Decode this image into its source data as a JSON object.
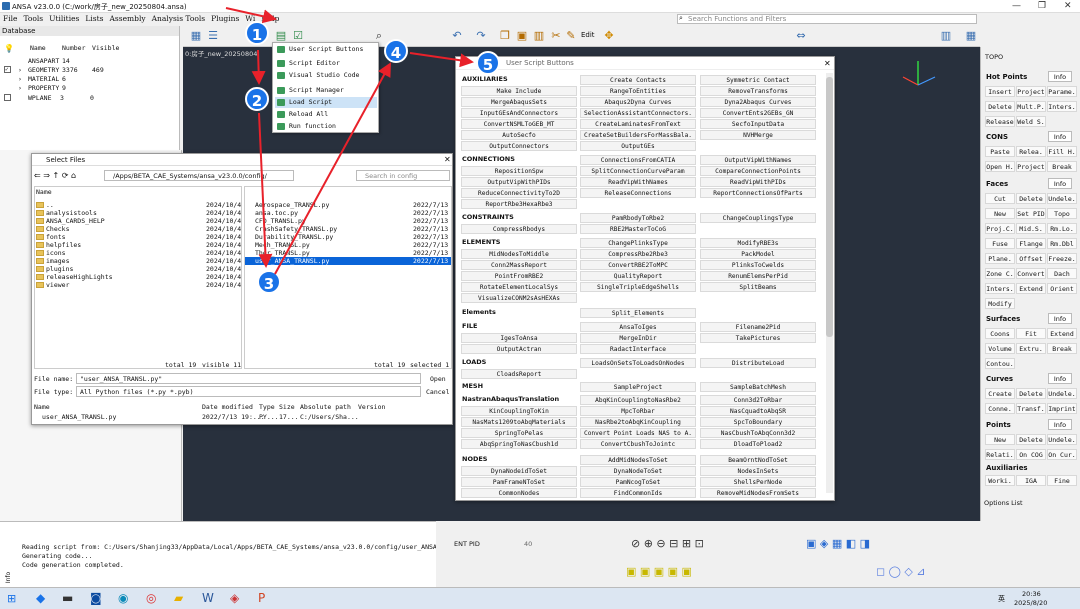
{
  "titlebar": {
    "title": "ANSA v23.0.0 (C:/work/房子_new_20250804.ansa)"
  },
  "menu": [
    "File",
    "Tools",
    "Utilities",
    "Lists",
    "Assembly",
    "Analysis Tools",
    "Plugins",
    "Wi",
    "Help"
  ],
  "search": {
    "placeholder": "Search Functions and Filters"
  },
  "toolbar": {
    "edit_label": "Edit"
  },
  "database": {
    "header": "Database",
    "columns": [
      "Name",
      "Number",
      "Visible"
    ],
    "rows": [
      {
        "name": "ANSAPART",
        "num": "14",
        "vis": ""
      },
      {
        "name": "GEOMETRY",
        "num": "3376",
        "vis": "469"
      },
      {
        "name": "MATERIAL",
        "num": "6",
        "vis": ""
      },
      {
        "name": "PROPERTY",
        "num": "9",
        "vis": ""
      },
      {
        "name": "WPLANE",
        "num": "3",
        "vis": "0"
      }
    ]
  },
  "viewport": {
    "tab": "0:房子_new_20250804"
  },
  "scriptmenu": {
    "items": [
      "User Script Buttons",
      "Script Editor",
      "Visual Studio Code",
      "Script Manager",
      "Load Script",
      "Reload All",
      "Run function"
    ]
  },
  "files": {
    "title": "Select Files",
    "path": "/Apps/BETA_CAE_Systems/ansa_v23.0.0/config/",
    "search_placeholder": "Search in config",
    "left_col": "Name",
    "left_date": "2024/10/4",
    "folders": [
      "..",
      "analysistools",
      "ANSA_CARDS_HELP",
      "Checks",
      "fonts",
      "helpfiles",
      "icons",
      "images",
      "plugins",
      "releaseHighLights",
      "viewer"
    ],
    "right_files": [
      "Aerospace_TRANSL.py",
      "ansa.toc.py",
      "CFD_TRANSL.py",
      "CrashSafety_TRANSL.py",
      "Durability_TRANSL.py",
      "Mech_TRANSL.py",
      "Ther_TRANSL.py",
      "user_ANSA_TRANSL.py"
    ],
    "right_date": "2022/7/13",
    "total_left": "total 19",
    "visible_left": "visible 11",
    "total_right": "total 19",
    "selected_right": "selected 1",
    "file_name_label": "File name:",
    "file_name": "\"user_ANSA_TRANSL.py\"",
    "open": "Open",
    "file_type_label": "File type:",
    "file_type": "All Python files (*.py *.pyb)",
    "cancel": "Cancel",
    "detail_cols": [
      "Name",
      "Date modified",
      "Type",
      "Size",
      "Absolute path",
      "Version"
    ],
    "detail_row": {
      "name": "user_ANSA_TRANSL.py",
      "date": "2022/7/13 19:...",
      "type": "PY...",
      "size": "17...",
      "path": "C:/Users/Sha..."
    }
  },
  "usb": {
    "title": "User Script Buttons",
    "sections": [
      {
        "label": "AUXILIARIES",
        "buttons": [
          "Make Include",
          "RangeToEntities",
          "MergeAbaqusSets",
          "Abaqus2Dyna Curves",
          "InputGEsAndConnectors",
          "SelectionAssistantConnectors.",
          "ConvertNSMLToGEB_MT",
          "CreateLaminatesFromText",
          "AutoSecfo",
          "CreateSetBuildersForMassBala.",
          "OutputConnectors",
          "OutputGEs"
        ],
        "top3": [
          "Create Contacts",
          "Symmetric Contact",
          "RemoveTransforms",
          "Dyna2Abaqus Curves",
          "ConvertEnts2GEBs_GN",
          "SecfoInputData",
          "NVHMerge"
        ]
      },
      {
        "label": "CONNECTIONS"
      },
      {
        "label": "CONSTRAINTS"
      },
      {
        "label": "ELEMENTS"
      },
      {
        "label": "Elements"
      },
      {
        "label": "FILE"
      },
      {
        "label": "LOADS"
      },
      {
        "label": "MESH"
      },
      {
        "label": "NastranAbaqusTranslation"
      },
      {
        "label": "NODES"
      }
    ],
    "conn": [
      "RepositionSpw",
      "ConnectionsFromCATIA",
      "OutputVipWithNames",
      "SplitConnectionCurveParam",
      "CompareConnectionPoints",
      "OutputVipWithPIDs",
      "ReadVipWithNames",
      "ReadVipWithPIDs",
      "ReduceConnectivityTo2D",
      "ReleaseConnections",
      "ReportConnectionsOfParts",
      "ReportRbe3HexaRbe3"
    ],
    "cons": [
      "PamRbodyToRbe2",
      "ChangeCouplingsType",
      "CompressRbodys",
      "RBE2MasterToCoG"
    ],
    "elem": [
      "ChangePlinksType",
      "ModifyRBE3s",
      "MidNodesToMiddle",
      "CompressRbe2Rbe3",
      "PackModel",
      "Conn2MassReport",
      "ConvertRBE2ToMPC",
      "PlinksToCwelds",
      "PointFromRBE2",
      "QualityReport",
      "RenumElemsPerPid",
      "RotateElementLocalSys",
      "SingleTripleEdgeShells",
      "SplitBeams",
      "VisualizeCONM2sAsHEXAs"
    ],
    "elements2": [
      "Split_Elements"
    ],
    "file": [
      "AnsaToIges",
      "Filename2Pid",
      "IgesToAnsa",
      "MergeInDir",
      "TakePictures",
      "OutputActran",
      "RadactInterface"
    ],
    "loads": [
      "LoadsOnSetsToLoadsOnNodes",
      "DistributeLoad",
      "CloadsReport"
    ],
    "mesh": [
      "SampleProject",
      "SampleBatchMesh"
    ],
    "nat": [
      "AbqKinCouplingtoNasRbe2",
      "Conn3d2ToRbar",
      "DloadToPload2",
      "KinCouplingToKin",
      "MpcToRbar",
      "NasCquadtoAbqSR",
      "NasMats1209toAbqMaterials",
      "NasRbe2toAbqKinCoupling",
      "SpcToBoundary",
      "SpringToPelas",
      "Convert Point Loads NAS to A.",
      "NasCbushToAbqConn3d2",
      "AbqSpringToNasCbush1d",
      "ConvertCbushToJointc"
    ],
    "nodes": [
      "AddMidNodesToSet",
      "BeamOrntNodToSet",
      "DynaNodeidToSet",
      "DynaNodeToSet",
      "NodesInSets",
      "PamFrameNToSet",
      "PamNcogToSet",
      "ShellsPerNode",
      "CommonNodes",
      "FindCommonIds",
      "RemoveMidNodesFromSets"
    ]
  },
  "rightbar": {
    "header": "TOPO",
    "info": "Info",
    "hot": {
      "label": "Hot Points",
      "btns": [
        "Insert",
        "Project",
        "Parame.",
        "Delete",
        "Mult.P.",
        "Inters.",
        "Release",
        "Weld S."
      ]
    },
    "cons": {
      "label": "CONS",
      "btns": [
        "Paste",
        "Relea.",
        "Fill H.",
        "Open H.",
        "Project",
        "Break"
      ]
    },
    "faces": {
      "label": "Faces",
      "btns": [
        "Cut",
        "Delete",
        "Undele.",
        "New",
        "Set PID",
        "Topo",
        "Proj.C.",
        "Mid.S.",
        "Rm.Lo.",
        "Fuse",
        "Flange",
        "Rm.Dbl",
        "Plane.",
        "Offset",
        "Freeze.",
        "Zone C.",
        "Convert",
        "Dach",
        "Inters.",
        "Extend",
        "Orient",
        "Modify"
      ]
    },
    "surfaces": {
      "label": "Surfaces",
      "btns": [
        "Coons",
        "Fit",
        "Extend",
        "Volume",
        "Extru.",
        "Break",
        "Contou."
      ]
    },
    "curves": {
      "label": "Curves",
      "btns": [
        "Create",
        "Delete",
        "Undele.",
        "Conne.",
        "Transf.",
        "Imprint"
      ]
    },
    "points": {
      "label": "Points",
      "btns": [
        "New",
        "Delete",
        "Undele.",
        "Relati.",
        "On COG",
        "On Cur."
      ]
    },
    "aux": {
      "label": "Auxiliaries",
      "btns": [
        "Worki.",
        "IGA",
        "Fine"
      ]
    },
    "options": "Options List"
  },
  "console": {
    "lines": [
      "Reading script from: C:/Users/Shanjing33/AppData/Local/Apps/BETA_CAE_Systems/ansa_v23.0.0/config/user_ANSA_TR",
      "Generating code...",
      "Code generation completed."
    ],
    "side": "Info"
  },
  "bottom": {
    "ent_pid": "ENT PID",
    "angle": "40",
    "time": "20:36",
    "date": "2025/8/20",
    "lang": "英"
  },
  "badges": [
    "1",
    "2",
    "3",
    "4",
    "5"
  ],
  "colors": {
    "badge": "#1a73e8",
    "arrow": "#e8212a",
    "viewport": "#28303d",
    "selection": "#0a64d8"
  }
}
